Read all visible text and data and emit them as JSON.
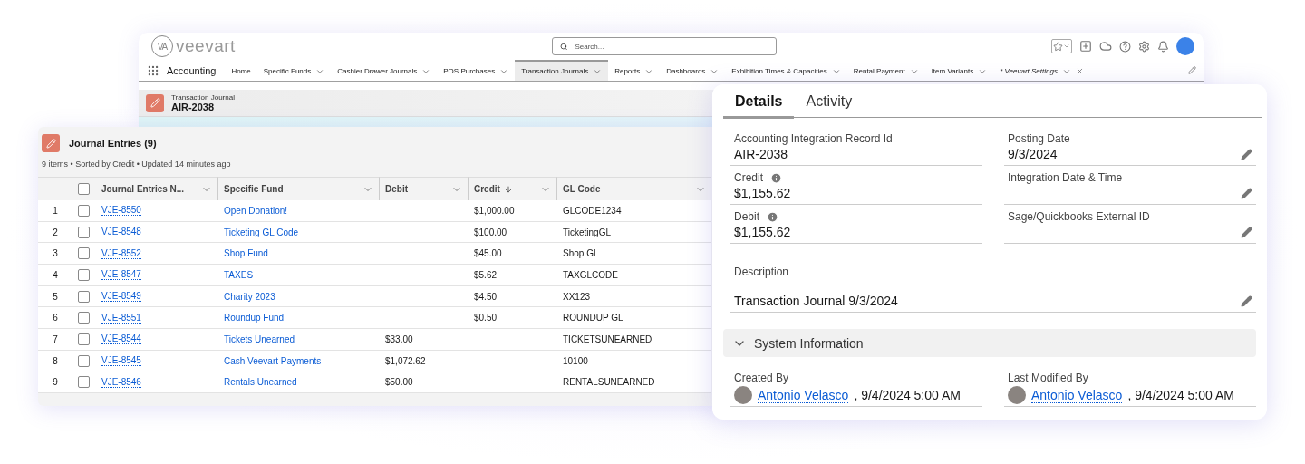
{
  "app": {
    "logo_mark": "VA",
    "logo_text": "veevart",
    "search": {
      "placeholder": "Search..."
    },
    "app_name": "Accounting",
    "nav_tabs": [
      {
        "label": "Home",
        "selected": false,
        "kind": "plain"
      },
      {
        "label": "Specific Funds",
        "selected": false,
        "kind": "menu"
      },
      {
        "label": "Cashier Drawer Journals",
        "selected": false,
        "kind": "menu"
      },
      {
        "label": "POS Purchases",
        "selected": false,
        "kind": "menu"
      },
      {
        "label": "Transaction Journals",
        "selected": true,
        "kind": "menu"
      },
      {
        "label": "Reports",
        "selected": false,
        "kind": "menu"
      },
      {
        "label": "Dashboards",
        "selected": false,
        "kind": "menu"
      },
      {
        "label": "Exhibition Times & Capacities",
        "selected": false,
        "kind": "menu"
      },
      {
        "label": "Rental Payment",
        "selected": false,
        "kind": "menu"
      },
      {
        "label": "Item Variants",
        "selected": false,
        "kind": "menu"
      },
      {
        "label": "* Veevart Settings",
        "selected": false,
        "kind": "temporary"
      }
    ],
    "record_header": {
      "type_label": "Transaction Journal",
      "title": "AIR-2038"
    }
  },
  "related_list": {
    "title": "Journal Entries (9)",
    "summary": "9 items • Sorted by Credit • Updated 14 minutes ago",
    "all_checked": false,
    "columns": [
      {
        "label": "Journal Entries N...",
        "sorted": false
      },
      {
        "label": "Specific Fund",
        "sorted": false
      },
      {
        "label": "Debit",
        "sorted": false
      },
      {
        "label": "Credit",
        "sorted": true
      },
      {
        "label": "GL Code",
        "sorted": false
      }
    ],
    "rows": [
      {
        "number": "1",
        "checked": false,
        "name": "VJE-8550",
        "fund": "Open Donation!",
        "credit": "$1,000.00",
        "gl_code": "GLCODE1234"
      },
      {
        "number": "2",
        "checked": false,
        "name": "VJE-8548",
        "fund": "Ticketing GL Code",
        "credit": "$100.00",
        "gl_code": "TicketingGL"
      },
      {
        "number": "3",
        "checked": false,
        "name": "VJE-8552",
        "fund": "Shop Fund",
        "credit": "$45.00",
        "gl_code": "Shop GL"
      },
      {
        "number": "4",
        "checked": false,
        "name": "VJE-8547",
        "fund": "TAXES",
        "credit": "$5.62",
        "gl_code": "TAXGLCODE"
      },
      {
        "number": "5",
        "checked": false,
        "name": "VJE-8549",
        "fund": "Charity 2023",
        "credit": "$4.50",
        "gl_code": "XX123"
      },
      {
        "number": "6",
        "checked": false,
        "name": "VJE-8551",
        "fund": "Roundup Fund",
        "credit": "$0.50",
        "gl_code": "ROUNDUP GL"
      },
      {
        "number": "7",
        "checked": false,
        "name": "VJE-8544",
        "fund": "Tickets Unearned",
        "debit": "$33.00",
        "gl_code": "TICKETSUNEARNED"
      },
      {
        "number": "8",
        "checked": false,
        "name": "VJE-8545",
        "fund": "Cash Veevart Payments",
        "debit": "$1,072.62",
        "gl_code": "10100"
      },
      {
        "number": "9",
        "checked": false,
        "name": "VJE-8546",
        "fund": "Rentals Unearned",
        "debit": "$50.00",
        "gl_code": "RENTALSUNEARNED"
      }
    ]
  },
  "details": {
    "tabs": [
      {
        "label": "Details",
        "selected": true
      },
      {
        "label": "Activity",
        "selected": false
      }
    ],
    "fields": [
      {
        "label": "Accounting Integration Record Id",
        "value": "AIR-2038",
        "info": false,
        "editable": false,
        "kind": "half"
      },
      {
        "label": "Posting Date",
        "value": "9/3/2024",
        "info": false,
        "editable": true,
        "kind": "half"
      },
      {
        "label": "Credit",
        "value": "$1,155.62",
        "info": true,
        "editable": false,
        "kind": "half"
      },
      {
        "label": "Integration Date & Time",
        "info": false,
        "editable": true,
        "kind": "half"
      },
      {
        "label": "Debit",
        "value": "$1,155.62",
        "info": true,
        "editable": false,
        "kind": "half"
      },
      {
        "label": "Sage/Quickbooks External ID",
        "info": false,
        "editable": true,
        "kind": "half"
      },
      {
        "label": "Description",
        "value": "Transaction Journal 9/3/2024",
        "info": false,
        "editable": true,
        "kind": "wide"
      }
    ],
    "section": {
      "title": "System Information",
      "expanded": true,
      "fields": [
        {
          "label": "Created By",
          "user": "Antonio Velasco",
          "date": ", 9/4/2024 5:00 AM"
        },
        {
          "label": "Last Modified By",
          "user": "Antonio Velasco",
          "date": ", 9/4/2024 5:00 AM"
        }
      ]
    }
  }
}
